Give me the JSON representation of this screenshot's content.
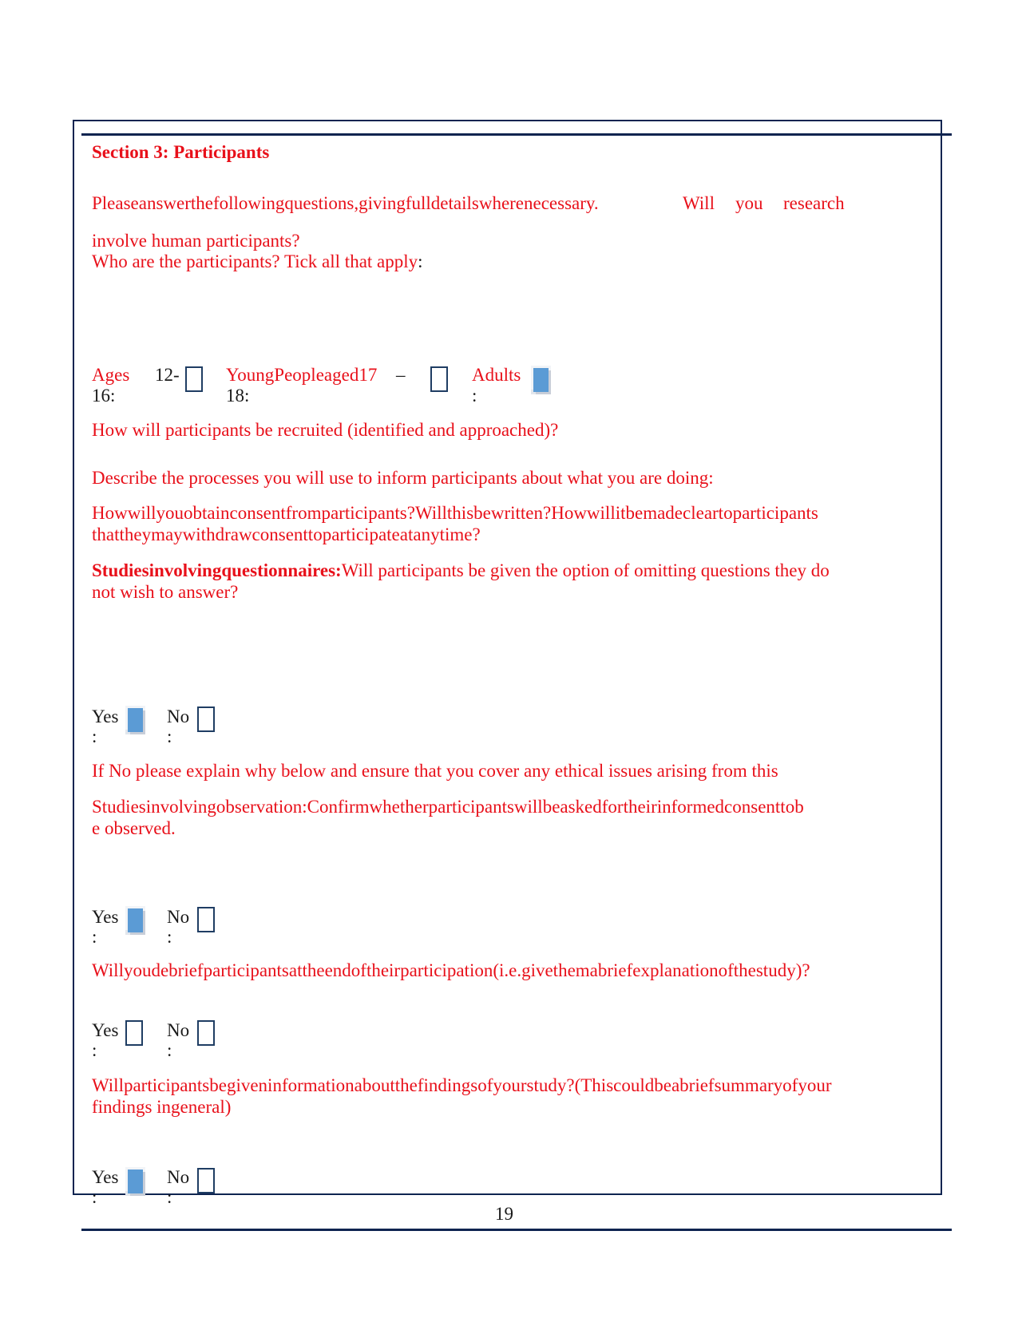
{
  "section": {
    "title": "Section 3: Participants",
    "intro_line1_a": "Pleaseanswerthefollowingquestions,givingfulldetailswherenecessary.",
    "intro_line1_b": "Will",
    "intro_line1_c": "you",
    "intro_line1_d": "research",
    "intro_line2": "involve human participants?",
    "who_prompt": "Who are the participants? Tick all that apply",
    "who_prompt_colon": ":"
  },
  "age_options": [
    {
      "label_a": "Ages",
      "label_b": "12-",
      "label_c": "16:",
      "checked": false
    },
    {
      "label_a": "YoungPeopleaged17",
      "label_b": "–",
      "label_c": "18:",
      "checked": false
    },
    {
      "label_a": "Adults",
      "label_c": ":",
      "checked": true
    }
  ],
  "questions": {
    "recruit": "How will participants be recruited (identified and approached)?",
    "inform": "Describe the processes you will use to inform participants about what you are doing:",
    "consent_line1": "Howwillyouobtainconsentfromparticipants?Willthisbewritten?Howwillitbemadecleartoparticipants",
    "consent_line2": "thattheymaywithdrawconsenttoparticipateatanytime?",
    "questionnaires_bold": "Studiesinvolvingquestionnaires:",
    "questionnaires_rest": "Will participants be given the option of omitting questions they do",
    "questionnaires_line2": "not wish to answer?",
    "if_no": "If No please explain why below and ensure that you cover any ethical issues arising from this",
    "observation_line1": "Studiesinvolvingobservation:Confirmwhetherparticipantswillbeaskedfortheirinformedconsenttob",
    "observation_line2": "e observed.",
    "debrief": "Willyoudebriefparticipantsattheendoftheirparticipation(i.e.givethemabriefexplanationofthestudy)?",
    "findings_line1": "Willparticipantsbegiveninformationaboutthefindingsofyourstudy?(Thiscouldbeabriefsummaryofyour",
    "findings_line2": "findings ingeneral)"
  },
  "yes_no_groups": [
    {
      "yes_label": "Yes",
      "no_label": "No",
      "colon": ":",
      "yes_checked": true,
      "no_checked": false
    },
    {
      "yes_label": "Yes",
      "no_label": "No",
      "colon": ":",
      "yes_checked": true,
      "no_checked": false
    },
    {
      "yes_label": "Yes",
      "no_label": "No",
      "colon": ":",
      "yes_checked": false,
      "no_checked": false
    },
    {
      "yes_label": "Yes",
      "no_label": "No",
      "colon": ":",
      "yes_checked": true,
      "no_checked": false
    }
  ],
  "footer": {
    "page_number": "19"
  },
  "colors": {
    "text_red": "#e8101a",
    "border_navy": "#0e2450",
    "checkbox_fill": "#5b9bd5"
  }
}
